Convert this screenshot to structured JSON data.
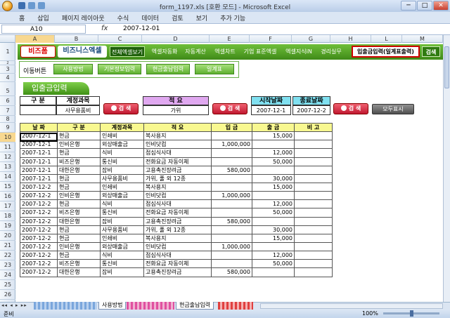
{
  "window": {
    "title": "form_1197.xls [호환 모드] - Microsoft Excel",
    "minimize": "─",
    "maximize": "□",
    "close": "✕"
  },
  "menu": [
    "홈",
    "삽입",
    "페이지 레이아웃",
    "수식",
    "데이터",
    "검토",
    "보기",
    "추가 기능"
  ],
  "formula_bar": {
    "cell": "A10",
    "fx": "fx",
    "value": "2007-12-01"
  },
  "columns": [
    "A",
    "B",
    "C",
    "D",
    "E",
    "F",
    "G",
    "H",
    "L",
    "M"
  ],
  "rows": [
    "1",
    "2",
    "3",
    "4",
    "5",
    "6",
    "7",
    "8",
    "9",
    "10",
    "11",
    "12",
    "13",
    "14",
    "15",
    "16",
    "17",
    "18",
    "19",
    "20",
    "21",
    "22",
    "23",
    "24",
    "25",
    "26"
  ],
  "banner": {
    "logo1": "비즈폼",
    "logo2": "비즈니스엑셀",
    "nav": [
      "전체엑셀보기",
      "엑셀자동화",
      "자동계산",
      "엑셀차트",
      "기업 표준엑셀",
      "엑셀지식iN",
      "경리실무"
    ],
    "report_button": "입출금입력(일계표출력)",
    "search_button": "검색"
  },
  "move": {
    "label": "이동버튼",
    "buttons": [
      "사용방법",
      "기본정보입력",
      "현금출납입력",
      "일계표"
    ]
  },
  "section_title": "입출금입력",
  "filters": {
    "type_header": "구 분",
    "type_value": "",
    "account_header": "계정과목",
    "account_value": "사무용품비",
    "desc_header": "적 요",
    "desc_value": "가위",
    "start_header": "시작날짜",
    "start_value": "2007-12-1",
    "end_header": "종료날짜",
    "end_value": "2007-12-2",
    "search_label": "검 색",
    "show_all": "모두표시"
  },
  "table": {
    "headers": [
      "날 짜",
      "구 분",
      "계정과목",
      "적 요",
      "입 금",
      "출 금",
      "비 고"
    ],
    "rows": [
      [
        "2007-12-1",
        "현금",
        "인쇄비",
        "복사용지",
        "",
        "15,000",
        ""
      ],
      [
        "2007-12-1",
        "인비은행",
        "외상매출금",
        "인비닷컴",
        "1,000,000",
        "",
        ""
      ],
      [
        "2007-12-1",
        "현금",
        "식비",
        "점심식사대",
        "",
        "12,000",
        ""
      ],
      [
        "2007-12-1",
        "비즈은행",
        "통신비",
        "전화요금 자동이체",
        "",
        "50,000",
        ""
      ],
      [
        "2007-12-1",
        "대한은행",
        "잡비",
        "고용촉진장려금",
        "580,000",
        "",
        ""
      ],
      [
        "2007-12-1",
        "현금",
        "사무용품비",
        "가위, 풀 외 12종",
        "",
        "30,000",
        ""
      ],
      [
        "2007-12-2",
        "현금",
        "인쇄비",
        "복사용지",
        "",
        "15,000",
        ""
      ],
      [
        "2007-12-2",
        "인비은행",
        "외상매출금",
        "인비닷컴",
        "1,000,000",
        "",
        ""
      ],
      [
        "2007-12-2",
        "현금",
        "식비",
        "점심식사대",
        "",
        "12,000",
        ""
      ],
      [
        "2007-12-2",
        "비즈은행",
        "통신비",
        "전화요금 자동이체",
        "",
        "50,000",
        ""
      ],
      [
        "2007-12-2",
        "대한은행",
        "잡비",
        "고용촉진장려금",
        "580,000",
        "",
        ""
      ],
      [
        "2007-12-2",
        "현금",
        "사무용품비",
        "가위, 풀 외 12종",
        "",
        "30,000",
        ""
      ],
      [
        "2007-12-2",
        "현금",
        "인쇄비",
        "복사용지",
        "",
        "15,000",
        ""
      ],
      [
        "2007-12-2",
        "인비은행",
        "외상매출금",
        "인비닷컴",
        "1,000,000",
        "",
        ""
      ],
      [
        "2007-12-2",
        "현금",
        "식비",
        "점심식사대",
        "",
        "12,000",
        ""
      ],
      [
        "2007-12-2",
        "비즈은행",
        "통신비",
        "전화요금 자동이체",
        "",
        "50,000",
        ""
      ],
      [
        "2007-12-2",
        "대한은행",
        "잡비",
        "고용촉진장려금",
        "580,000",
        "",
        ""
      ]
    ]
  },
  "tabs": {
    "nav": "◂◂ ◂ ▸ ▸▸",
    "sheets": [
      "사용방법",
      "현금출납입력"
    ]
  },
  "status": {
    "text": "준비",
    "zoom": "100%"
  }
}
